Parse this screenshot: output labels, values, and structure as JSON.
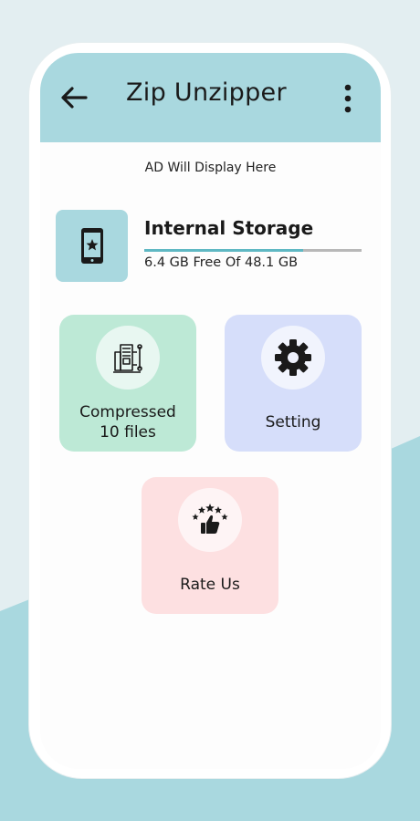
{
  "header": {
    "title": "Zip Unzipper",
    "back_icon": "arrow-left-icon",
    "menu_icon": "more-vertical-icon"
  },
  "ad": {
    "text": "AD Will Display Here"
  },
  "storage": {
    "title": "Internal Storage",
    "summary": "6.4 GB Free Of 48.1 GB",
    "used_fraction": 0.733,
    "icon": "phone-star-icon"
  },
  "cards": {
    "compressed": {
      "label": "Compressed",
      "count": "10 files",
      "icon": "file-compress-icon"
    },
    "setting": {
      "label": "Setting",
      "icon": "gear-icon"
    },
    "rate": {
      "label": "Rate Us",
      "icon": "thumbs-up-stars-icon"
    }
  },
  "colors": {
    "appbar": "#a9d8df",
    "compressed_card": "#bde9d6",
    "setting_card": "#d6defa",
    "rate_card": "#fde0e1",
    "progress": "#5fb8c3"
  }
}
